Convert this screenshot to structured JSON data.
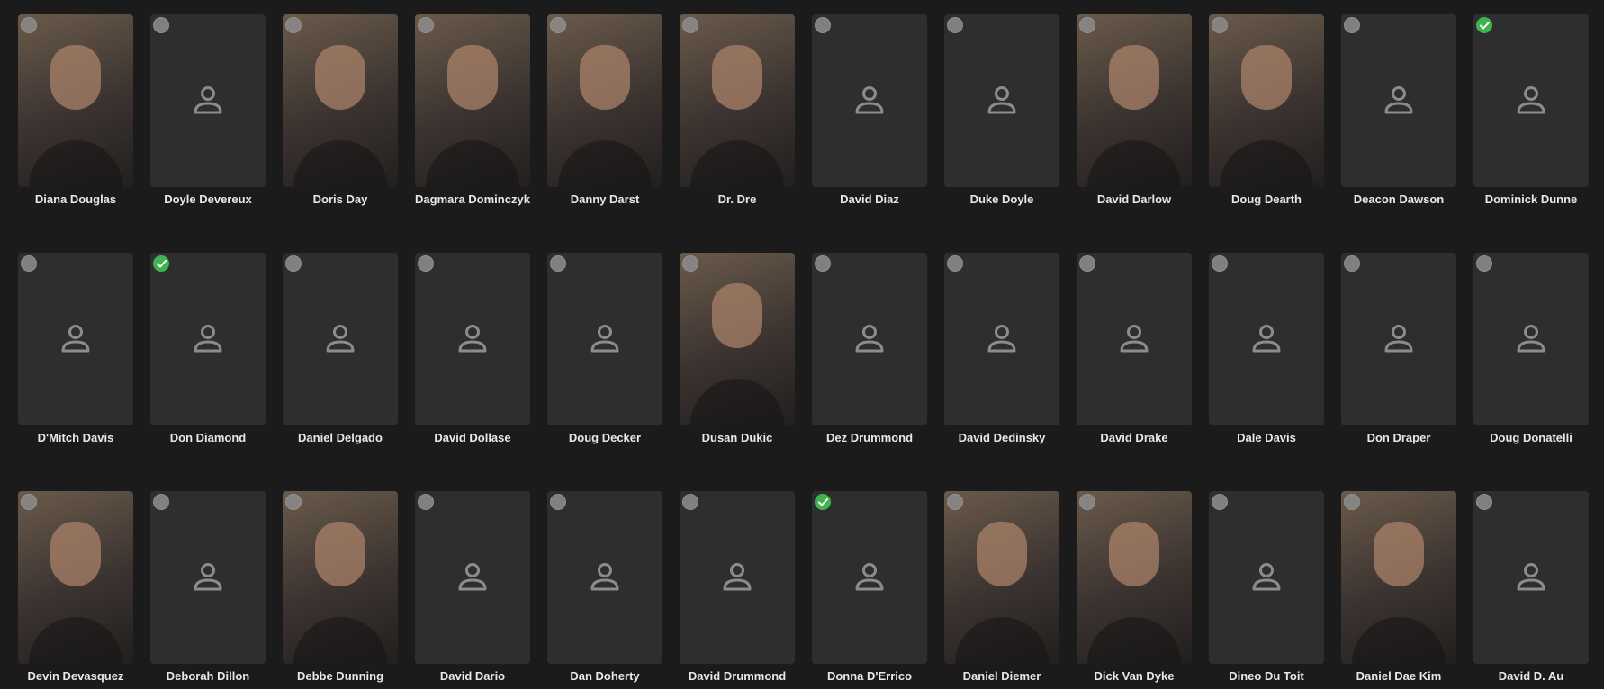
{
  "colors": {
    "background": "#1b1b1b",
    "card": "#2e2e2e",
    "check": "#3fb34f",
    "text": "#e8e8e8"
  },
  "icons": {
    "placeholder": "person-outline-icon",
    "selected": "check-icon"
  },
  "rows": [
    [
      {
        "name": "Diana Douglas",
        "photo": true,
        "checked": false
      },
      {
        "name": "Doyle Devereux",
        "photo": false,
        "checked": false
      },
      {
        "name": "Doris Day",
        "photo": true,
        "checked": false
      },
      {
        "name": "Dagmara Dominczyk",
        "photo": true,
        "checked": false
      },
      {
        "name": "Danny Darst",
        "photo": true,
        "checked": false
      },
      {
        "name": "Dr. Dre",
        "photo": true,
        "checked": false
      },
      {
        "name": "David Diaz",
        "photo": false,
        "checked": false
      },
      {
        "name": "Duke Doyle",
        "photo": false,
        "checked": false
      },
      {
        "name": "David Darlow",
        "photo": true,
        "checked": false
      },
      {
        "name": "Doug Dearth",
        "photo": true,
        "checked": false
      },
      {
        "name": "Deacon Dawson",
        "photo": false,
        "checked": false
      },
      {
        "name": "Dominick Dunne",
        "photo": false,
        "checked": true
      }
    ],
    [
      {
        "name": "D'Mitch Davis",
        "photo": false,
        "checked": false
      },
      {
        "name": "Don Diamond",
        "photo": false,
        "checked": true
      },
      {
        "name": "Daniel Delgado",
        "photo": false,
        "checked": false
      },
      {
        "name": "David Dollase",
        "photo": false,
        "checked": false
      },
      {
        "name": "Doug Decker",
        "photo": false,
        "checked": false
      },
      {
        "name": "Dusan Dukic",
        "photo": true,
        "checked": false
      },
      {
        "name": "Dez Drummond",
        "photo": false,
        "checked": false
      },
      {
        "name": "David Dedinsky",
        "photo": false,
        "checked": false
      },
      {
        "name": "David Drake",
        "photo": false,
        "checked": false
      },
      {
        "name": "Dale Davis",
        "photo": false,
        "checked": false
      },
      {
        "name": "Don Draper",
        "photo": false,
        "checked": false
      },
      {
        "name": "Doug Donatelli",
        "photo": false,
        "checked": false
      }
    ],
    [
      {
        "name": "Devin Devasquez",
        "photo": true,
        "checked": false
      },
      {
        "name": "Deborah Dillon",
        "photo": false,
        "checked": false
      },
      {
        "name": "Debbe Dunning",
        "photo": true,
        "checked": false
      },
      {
        "name": "David Dario",
        "photo": false,
        "checked": false
      },
      {
        "name": "Dan Doherty",
        "photo": false,
        "checked": false
      },
      {
        "name": "David Drummond",
        "photo": false,
        "checked": false
      },
      {
        "name": "Donna D'Errico",
        "photo": false,
        "checked": true
      },
      {
        "name": "Daniel Diemer",
        "photo": true,
        "checked": false
      },
      {
        "name": "Dick Van Dyke",
        "photo": true,
        "checked": false
      },
      {
        "name": "Dineo Du Toit",
        "photo": false,
        "checked": false
      },
      {
        "name": "Daniel Dae Kim",
        "photo": true,
        "checked": false
      },
      {
        "name": "David D. Au",
        "photo": false,
        "checked": false
      }
    ]
  ]
}
